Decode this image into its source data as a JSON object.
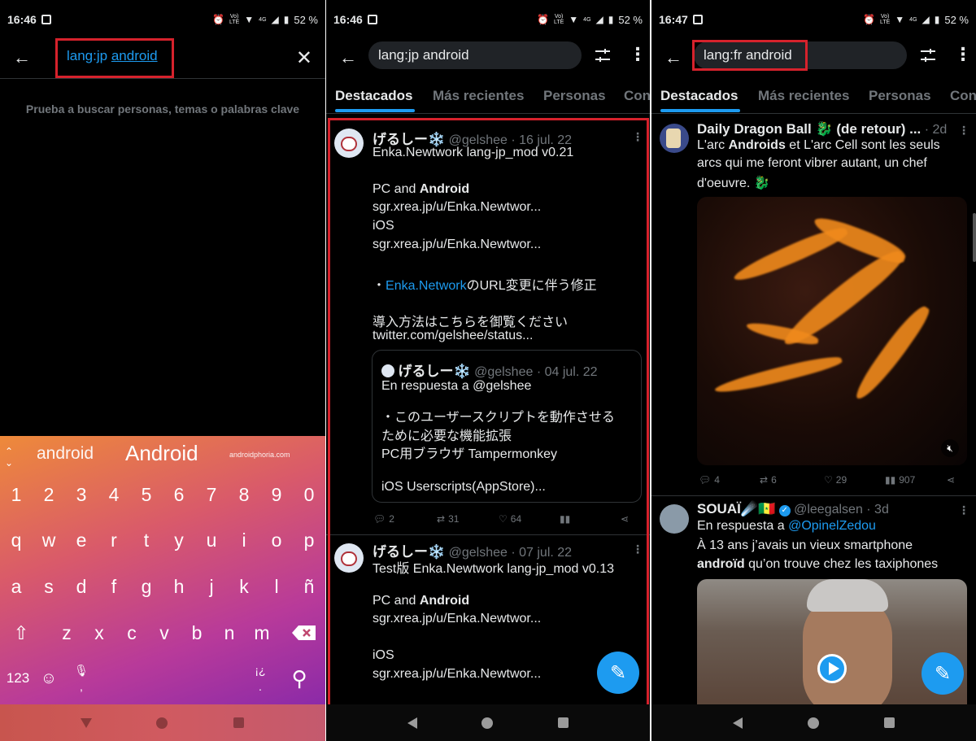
{
  "status": {
    "p1_time": "16:46",
    "p2_time": "16:46",
    "p3_time": "16:47",
    "battery": "52 %",
    "net_4g": "4G",
    "volte_top": "Vo)",
    "volte_bottom": "LTE"
  },
  "panel1": {
    "query": "lang:jp",
    "query_word": "android",
    "hint": "Prueba a buscar personas, temas o palabras clave",
    "keyboard": {
      "suggestions": [
        "android",
        "Android",
        "androidphoria.com"
      ],
      "rows": [
        [
          "1",
          "2",
          "3",
          "4",
          "5",
          "6",
          "7",
          "8",
          "9",
          "0"
        ],
        [
          "q",
          "w",
          "e",
          "r",
          "t",
          "y",
          "u",
          "i",
          "o",
          "p"
        ],
        [
          "a",
          "s",
          "d",
          "f",
          "g",
          "h",
          "j",
          "k",
          "l",
          "ñ"
        ],
        [
          "z",
          "x",
          "c",
          "v",
          "b",
          "n",
          "m"
        ]
      ],
      "numbers_key": "123",
      "comma_key": ",",
      "period_key": ".",
      "punct_key": "¡¿"
    }
  },
  "panel2": {
    "query": "lang:jp android",
    "tabs": [
      "Destacados",
      "Más recientes",
      "Personas",
      "Con"
    ],
    "tweet1": {
      "name": "げるしー❄️",
      "meta": "@gelshee · 16 jul. 22",
      "line1": "Enka.Newtwork lang-jp_mod v0.21",
      "pc": "PC and ",
      "pc_bold": "Android",
      "link1": "sgr.xrea.jp/u/Enka.Newtwor...",
      "ios": "iOS",
      "link2": "sgr.xrea.jp/u/Enka.Newtwor...",
      "bullet_pre": "・",
      "bullet_link": "Enka.Network",
      "bullet_post": "のURL変更に伴う修正",
      "jp_line": "導入方法はこちらを御覧ください",
      "link3": "twitter.com/gelshee/status...",
      "quote": {
        "name": "げるしー❄️",
        "meta": "@gelshee · 04 jul. 22",
        "reply": "En respuesta a @gelshee",
        "l1": "・このユーザースクリプトを動作させる",
        "l2": "ために必要な機能拡張",
        "l3": "PC用ブラウザ Tampermonkey",
        "l4": "iOS Userscripts(AppStore)..."
      },
      "replies": "2",
      "retweets": "31",
      "likes": "64"
    },
    "tweet2": {
      "name": "げるしー❄️",
      "meta": "@gelshee · 07 jul. 22",
      "line1": "Test版 Enka.Newtwork lang-jp_mod v0.13",
      "pc": "PC and ",
      "pc_bold": "Android",
      "link1": "sgr.xrea.jp/u/Enka.Newtwor...",
      "ios": "iOS",
      "link2": "sgr.xrea.jp/u/Enka.Newtwor..."
    }
  },
  "panel3": {
    "query": "lang:fr android",
    "tabs": [
      "Destacados",
      "Más recientes",
      "Personas",
      "Con"
    ],
    "tweet1": {
      "name": "Daily Dragon Ball 🐉 (de retour) ...",
      "meta": "· 2d",
      "l1_pre": "L'arc ",
      "l1_bold": "Androids",
      "l1_post": " et L'arc Cell sont les seuls",
      "l2": "arcs qui me feront vibrer autant, un chef",
      "l3": "d'oeuvre. 🐉",
      "replies": "4",
      "retweets": "6",
      "likes": "29",
      "views": "907"
    },
    "tweet2": {
      "name": "SOUAÏ☄️🇸🇳",
      "meta": "@leegalsen · 3d",
      "reply_pre": "En respuesta a ",
      "reply_link": "@OpinelZedou",
      "l1": "À 13 ans j’avais un vieux smartphone",
      "l2_bold": "androïd",
      "l2_post": " qu’on trouve chez les taxiphones"
    }
  },
  "colors": {
    "accent": "#1d9bf0",
    "highlight": "#d6222c",
    "bg": "#000000",
    "muted": "#71767b"
  },
  "icons": [
    "back-arrow-icon",
    "close-icon",
    "filter-icon",
    "more-icon",
    "reply-icon",
    "retweet-icon",
    "like-icon",
    "views-icon",
    "share-icon",
    "compose-icon",
    "emoji-icon",
    "mic-icon",
    "search-icon",
    "shift-icon",
    "backspace-icon",
    "mute-icon",
    "play-icon",
    "verified-icon"
  ]
}
